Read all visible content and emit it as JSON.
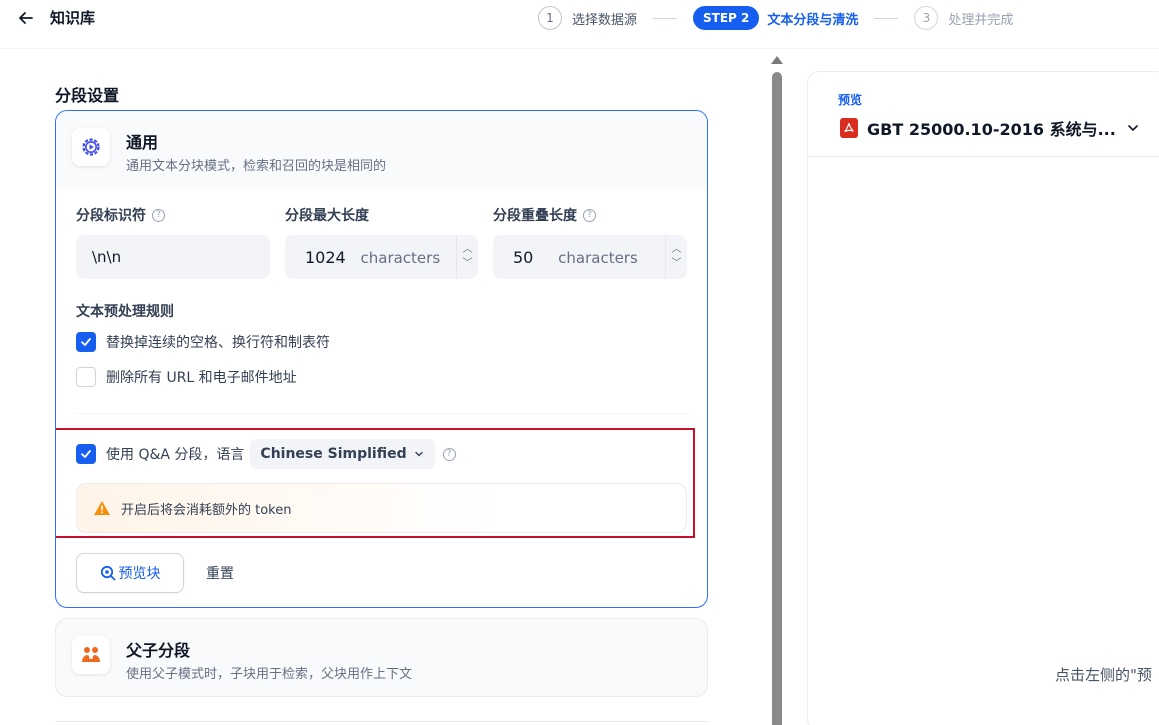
{
  "header": {
    "title": "知识库",
    "steps": [
      {
        "number": "1",
        "label": "选择数据源"
      },
      {
        "pill": "STEP 2",
        "label": "文本分段与清洗"
      },
      {
        "number": "3",
        "label": "处理并完成"
      }
    ]
  },
  "segment_settings": {
    "title": "分段设置",
    "general": {
      "title": "通用",
      "description": "通用文本分块模式，检索和召回的块是相同的",
      "fields": {
        "separator": {
          "label": "分段标识符",
          "value": "\\n\\n"
        },
        "max_length": {
          "label": "分段最大长度",
          "value": "1024",
          "unit": "characters"
        },
        "overlap": {
          "label": "分段重叠长度",
          "value": "50",
          "unit": "characters"
        }
      },
      "preprocess": {
        "title": "文本预处理规则",
        "rules": [
          {
            "label": "替换掉连续的空格、换行符和制表符",
            "checked": true
          },
          {
            "label": "删除所有 URL 和电子邮件地址",
            "checked": false
          }
        ]
      },
      "qa": {
        "label": "使用 Q&A 分段，语言",
        "checked": true,
        "language": "Chinese Simplified",
        "warning": "开启后将会消耗额外的 token"
      },
      "preview_button": "预览块",
      "reset_button": "重置"
    },
    "parent_child": {
      "title": "父子分段",
      "description": "使用父子模式时，子块用于检索，父块用作上下文"
    }
  },
  "preview": {
    "label": "预览",
    "document": "GBT 25000.10-2016 系统与...",
    "hint": "点击左侧的\"预"
  },
  "colors": {
    "accent": "#155eef",
    "highlight_border": "#c8102e",
    "warning": "#f79009",
    "pdf": "#d92d20"
  }
}
